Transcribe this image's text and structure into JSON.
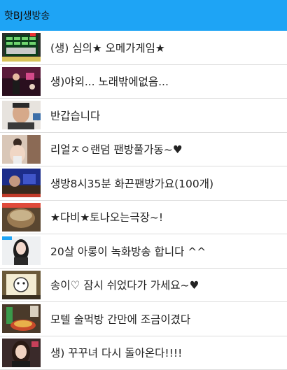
{
  "app": {
    "title": "핫BJ생방송"
  },
  "accent_color": "#1ea4f5",
  "items": [
    {
      "title": "(생) 심의★ 오메가게임★",
      "thumb": "game-board-thumbnail"
    },
    {
      "title": "생)야외... 노래밖에없음...",
      "thumb": "night-singer-thumbnail"
    },
    {
      "title": "반갑습니다",
      "thumb": "man-face-thumbnail"
    },
    {
      "title": "리얼ㅈㅇ랜덤 팬방풀가동~♥",
      "thumb": "woman-room-thumbnail"
    },
    {
      "title": "생방8시35분 화끈팬방가요(100개)",
      "thumb": "blue-room-thumbnail"
    },
    {
      "title": "★다비★토나오는극장~!",
      "thumb": "pot-thumbnail"
    },
    {
      "title": "20살 아롱이 녹화방송 합니다 ^^",
      "thumb": "girl-webcam-thumbnail"
    },
    {
      "title": "송이♡  잠시 쉬었다가 가세요~♥",
      "thumb": "cartoon-thumbnail"
    },
    {
      "title": "모텔 술먹방 간만에 조금이겼다",
      "thumb": "food-drink-thumbnail"
    },
    {
      "title": "생) 꾸꾸녀 다시 돌아온다!!!!",
      "thumb": "streamer-thumbnail"
    }
  ]
}
